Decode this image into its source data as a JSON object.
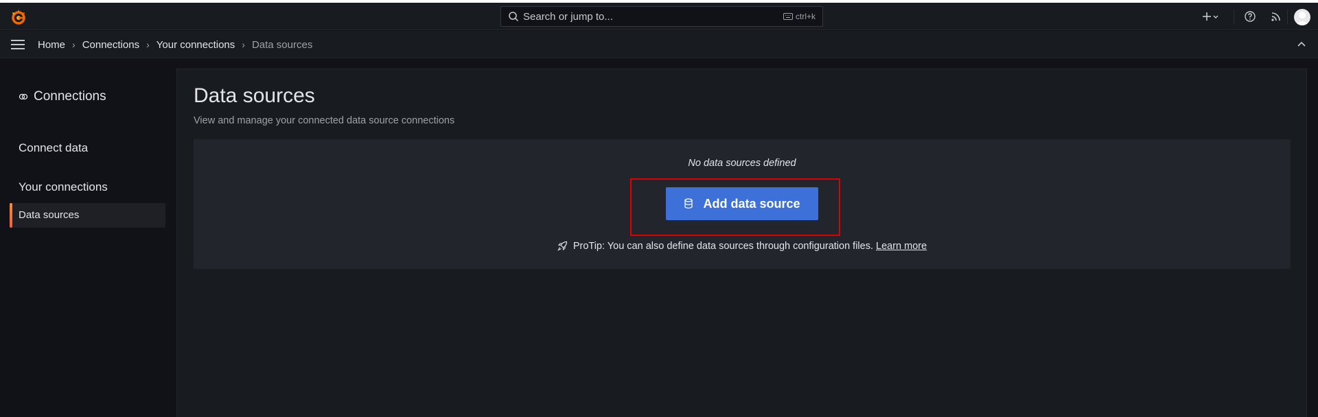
{
  "search": {
    "placeholder": "Search or jump to...",
    "shortcut": "ctrl+k"
  },
  "breadcrumb": {
    "items": [
      "Home",
      "Connections",
      "Your connections",
      "Data sources"
    ],
    "separator": "›"
  },
  "sidebar": {
    "title": "Connections",
    "items": [
      {
        "label": "Connect data"
      },
      {
        "label": "Your connections"
      },
      {
        "label": "Data sources",
        "active": true
      }
    ]
  },
  "main": {
    "title": "Data sources",
    "subtitle": "View and manage your connected data source connections",
    "empty_message": "No data sources defined",
    "add_button_label": "Add data source",
    "protip_text": "ProTip: You can also define data sources through configuration files.",
    "protip_link": "Learn more"
  },
  "colors": {
    "background": "#111217",
    "panel": "#181b1f",
    "primary_button": "#3d71d9",
    "highlight": "#e10000",
    "active_accent": "#f55f3e"
  },
  "icons": [
    "grafana-logo-icon",
    "search-icon",
    "keyboard-icon",
    "plus-icon",
    "chevron-down-icon",
    "help-icon",
    "rss-icon",
    "avatar",
    "hamburger-icon",
    "chevron-up-icon",
    "connections-icon",
    "database-icon",
    "rocket-icon"
  ]
}
